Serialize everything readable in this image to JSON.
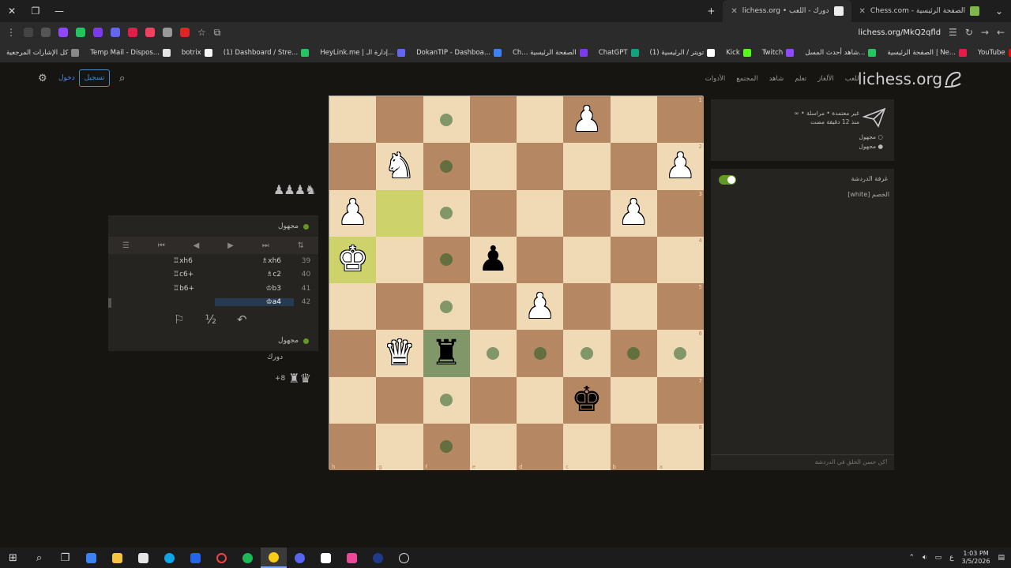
{
  "browser": {
    "tabs": [
      {
        "title": "Chess.com - الصفحة الرئيسية",
        "active": false
      },
      {
        "title": "lichess.org • دورك - اللعب",
        "active": true
      }
    ],
    "url": "lichess.org/MkQ2qfld",
    "bookmarks": [
      {
        "label": "YouTube",
        "color": "#ff0000"
      },
      {
        "label": "الصفحة الرئيسية | Ne...",
        "color": "#e11d48"
      },
      {
        "label": "شاهد أحدث المسل...",
        "color": "#22c55e"
      },
      {
        "label": "Twitch",
        "color": "#9146ff"
      },
      {
        "label": "Kick",
        "color": "#53fc18"
      },
      {
        "label": "(1) تويتر / الرئيسية",
        "color": "#ffffff"
      },
      {
        "label": "ChatGPT",
        "color": "#10a37f"
      },
      {
        "label": "Ch... الصفحة الرئيسية",
        "color": "#7c3aed"
      },
      {
        "label": "DokanTIP - Dashboa...",
        "color": "#3b82f6"
      },
      {
        "label": "HeyLink.me | إدارة الـ...",
        "color": "#6366f1"
      },
      {
        "label": "(1) Dashboard / Stre...",
        "color": "#22c55e"
      },
      {
        "label": "botrix",
        "color": "#f5f5f5"
      },
      {
        "label": "Temp Mail - Dispos...",
        "color": "#e5e5e5"
      },
      {
        "label": "كل الإشارات المرجعية",
        "color": "#888888"
      }
    ]
  },
  "header": {
    "logo": "lichess.org",
    "signup": "تسجيل",
    "login": "دخول",
    "nav": [
      "اللعب",
      "الألغاز",
      "تعلم",
      "شاهد",
      "المجتمع",
      "الأدوات"
    ]
  },
  "game": {
    "top_material": "♟♟♟♞",
    "top_player": "مجهول",
    "bottom_player": "مجهول",
    "turn_label": "دورك",
    "bottom_material": "♜♛",
    "bottom_score": "+8",
    "moves": [
      {
        "num": "39",
        "a": "♖xh6",
        "b": "♗xh6"
      },
      {
        "num": "40",
        "a": "♖c6+",
        "b": "♗c2"
      },
      {
        "num": "41",
        "a": "♖b6+",
        "b": "♔b3"
      },
      {
        "num": "42",
        "a": "",
        "b": "♔a4",
        "current": true
      }
    ],
    "controls": [
      "⏮",
      "◀",
      "▶",
      "⏭"
    ],
    "actions": {
      "resign": "⚐",
      "draw": "½",
      "takeback": "↶"
    }
  },
  "invite": {
    "line1": "∞ • غير معتمدة • مراسلة",
    "link": "مراسلة",
    "line2": "منذ 12 دقيقة مضت",
    "player1": "مجهول",
    "player2": "مجهول"
  },
  "chat": {
    "title": "غرفة الدردشة",
    "line": "[white] الخصم",
    "placeholder": "كن حسن الخلق في الدردشة!"
  },
  "board": {
    "ranks": [
      "1",
      "2",
      "3",
      "4",
      "5",
      "6",
      "7",
      "8"
    ],
    "files": [
      "h",
      "g",
      "f",
      "e",
      "d",
      "c",
      "b",
      "a"
    ],
    "pieces": [
      {
        "sq": "c1",
        "glyph": "♟",
        "color": "white",
        "name": "white-pawn-h7"
      },
      {
        "sq": "a2",
        "glyph": "♟",
        "color": "white",
        "name": "white-pawn"
      },
      {
        "sq": "g2",
        "glyph": "♞",
        "color": "white",
        "name": "white-knight"
      },
      {
        "sq": "b3",
        "glyph": "♟",
        "color": "white",
        "name": "white-pawn"
      },
      {
        "sq": "h3",
        "glyph": "♟",
        "color": "white",
        "name": "white-pawn"
      },
      {
        "sq": "e4",
        "glyph": "♟",
        "color": "black",
        "name": "black-pawn"
      },
      {
        "sq": "h4",
        "glyph": "♚",
        "color": "white",
        "name": "white-king"
      },
      {
        "sq": "d5",
        "glyph": "♟",
        "color": "white",
        "name": "white-pawn"
      },
      {
        "sq": "f6",
        "glyph": "♜",
        "color": "black",
        "name": "black-rook"
      },
      {
        "sq": "g6",
        "glyph": "♛",
        "color": "white",
        "name": "white-queen"
      },
      {
        "sq": "c7",
        "glyph": "♚",
        "color": "black",
        "name": "black-king"
      }
    ],
    "highlights": {
      "last_move": [
        "g3",
        "h4"
      ],
      "selected": "f6"
    },
    "dests": [
      "f1",
      "f2",
      "f3",
      "f4",
      "f5",
      "a6",
      "b6",
      "c6",
      "d6",
      "e6",
      "f7",
      "f8"
    ]
  },
  "taskbar": {
    "time": "1:03 PM",
    "date": "3/5/2026",
    "lang": "ع"
  }
}
